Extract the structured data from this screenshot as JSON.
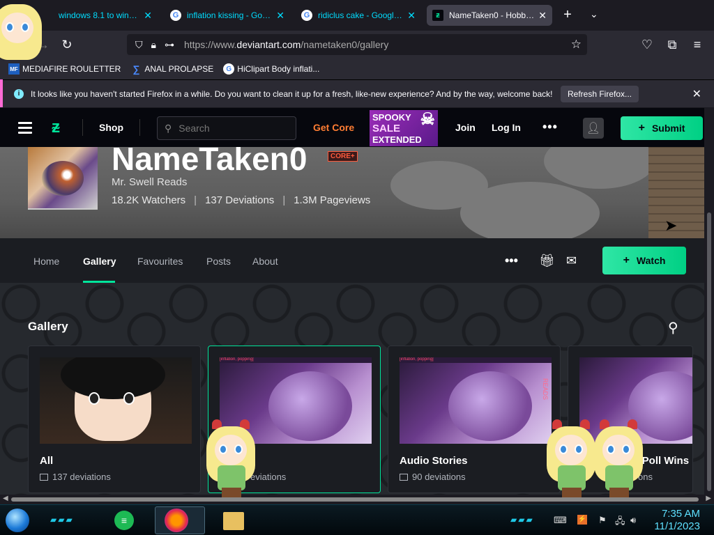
{
  "browser": {
    "tabs": [
      {
        "title": "windows 8.1 to window",
        "favicon": "",
        "active": false
      },
      {
        "title": "inflation kissing - Google",
        "favicon": "G",
        "active": false
      },
      {
        "title": "ridiclus cake - Google Se",
        "favicon": "G",
        "active": false
      },
      {
        "title": "NameTaken0 - Hobbyist",
        "favicon": "DA",
        "active": true
      }
    ],
    "new_tab": "+",
    "tab_list": "⌄",
    "url_prefix": "https://www.",
    "url_domain": "deviantart.com",
    "url_path": "/nametaken0/gallery",
    "bookmarks": [
      {
        "label": "MEDIAFIRE ROULETTER",
        "icon": "MF"
      },
      {
        "label": "ANAL PROLAPSE",
        "icon": "∑"
      },
      {
        "label": "HiClipart  Body inflati...",
        "icon": "G"
      }
    ],
    "notification": {
      "message": "It looks like you haven't started Firefox in a while. Do you want to clean it up for a fresh, like-new experience? And by the way, welcome back!",
      "button": "Refresh Firefox..."
    }
  },
  "da_header": {
    "shop": "Shop",
    "search_placeholder": "Search",
    "get_core": "Get Core",
    "promo": {
      "line1": "SPOOKY",
      "line2": "SALE",
      "line3": "EXTENDED"
    },
    "join": "Join",
    "login": "Log In",
    "more": "•••",
    "submit": "Submit"
  },
  "profile": {
    "name": "NameTaken0",
    "badge": "CORE+",
    "tagline": "Mr. Swell Reads",
    "watchers": "18.2K Watchers",
    "deviations": "137 Deviations",
    "pageviews": "1.3M Pageviews",
    "tabs": [
      "Home",
      "Gallery",
      "Favourites",
      "Posts",
      "About"
    ],
    "active_tab": "Gallery",
    "watch": "Watch"
  },
  "gallery": {
    "title": "Gallery",
    "folders": [
      {
        "name": "All",
        "count": "137 deviations"
      },
      {
        "name": "ed",
        "count": "eviations"
      },
      {
        "name": "Audio Stories",
        "count": "90 deviations"
      },
      {
        "name": "z Poll Wins",
        "count": "ons"
      }
    ],
    "thumb_text": "[inflation, popping]",
    "thumb_side_text": "READS"
  },
  "taskbar": {
    "time": "7:35 AM",
    "date": "11/1/2023"
  },
  "colors": {
    "accent": "#00e59b",
    "get_core": "#ff7d33",
    "cyan_link": "#00ddff"
  }
}
